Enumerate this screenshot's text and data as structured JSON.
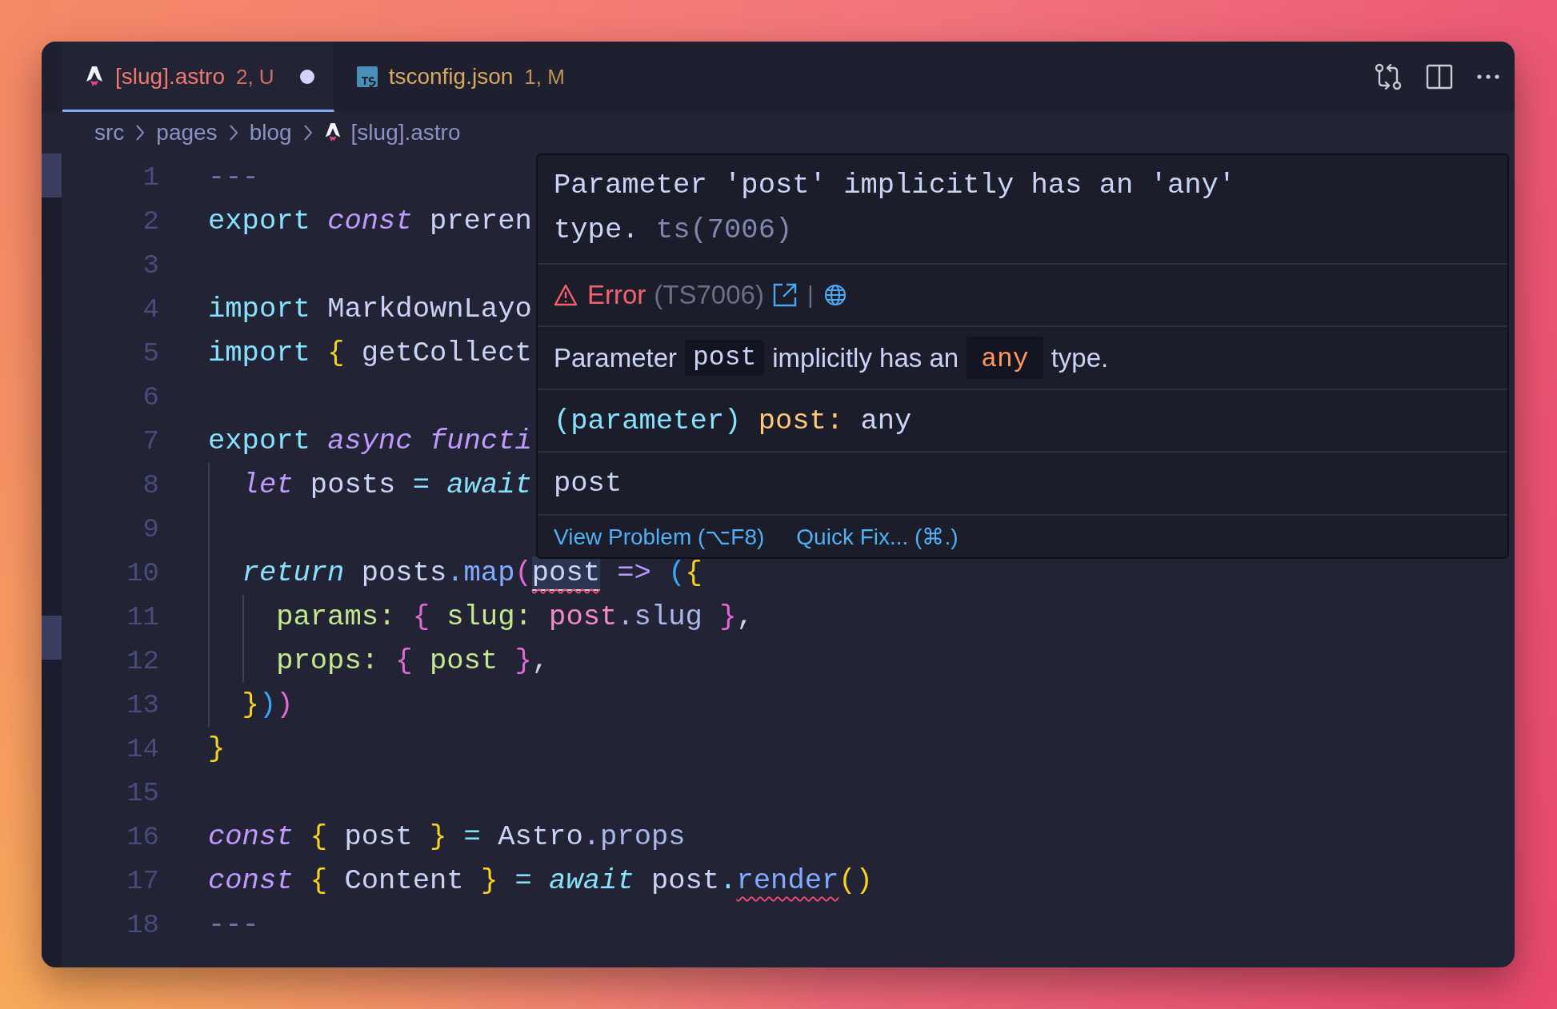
{
  "tabs": [
    {
      "label": "[slug].astro",
      "status": "2, U",
      "kind": "astro",
      "color": "#f0786e",
      "selected": true,
      "dirty": true
    },
    {
      "label": "tsconfig.json",
      "status": "1, M",
      "kind": "ts",
      "color": "#d9a85f",
      "selected": false,
      "dirty": false
    }
  ],
  "breadcrumb": [
    {
      "label": "src",
      "kind": "folder"
    },
    {
      "label": "pages",
      "kind": "folder"
    },
    {
      "label": "blog",
      "kind": "folder"
    },
    {
      "label": "[slug].astro",
      "kind": "astro"
    }
  ],
  "editor": {
    "lines": [
      {
        "number": "1",
        "tokens": [
          {
            "text": "---",
            "kind": "muted"
          }
        ]
      },
      {
        "number": "2",
        "tokens": [
          {
            "text": "export",
            "kind": "keyword"
          },
          {
            "text": " const",
            "kind": "storage"
          },
          {
            "text": " preren",
            "kind": "plain"
          }
        ]
      },
      {
        "number": "3"
      },
      {
        "number": "4",
        "tokens": [
          {
            "text": "import",
            "kind": "keyword"
          },
          {
            "text": " MarkdownLayo",
            "kind": "plain"
          }
        ]
      },
      {
        "number": "5",
        "tokens": [
          {
            "text": "import",
            "kind": "keyword"
          },
          {
            "text": " {",
            "kind": "yellow"
          },
          {
            "text": " getCollect",
            "kind": "plain"
          }
        ]
      },
      {
        "number": "6"
      },
      {
        "number": "7",
        "tokens": [
          {
            "text": "export",
            "kind": "keyword"
          },
          {
            "text": " async functi",
            "kind": "storage"
          }
        ]
      },
      {
        "number": "8",
        "tokens": [
          {
            "text": "  let",
            "kind": "storage"
          },
          {
            "text": " posts ",
            "kind": "plain"
          },
          {
            "text": "=",
            "kind": "keyword"
          },
          {
            "text": " await",
            "kind": "flow"
          }
        ]
      },
      {
        "number": "9"
      },
      {
        "number": "10",
        "tokens": [
          {
            "text": "  return",
            "kind": "flow"
          },
          {
            "text": " posts",
            "kind": "plain"
          },
          {
            "text": ".map",
            "kind": "method"
          },
          {
            "text": "(",
            "kind": "pink"
          },
          {
            "text": "post",
            "kind": "hovered-error"
          },
          {
            "text": " =>",
            "kind": "arrow"
          },
          {
            "text": " (",
            "kind": "blue"
          },
          {
            "text": "{",
            "kind": "yellow"
          }
        ]
      },
      {
        "number": "11",
        "tokens": [
          {
            "text": "    params:",
            "kind": "prop"
          },
          {
            "text": " {",
            "kind": "pink"
          },
          {
            "text": " slug:",
            "kind": "prop"
          },
          {
            "text": " post",
            "kind": "rose"
          },
          {
            "text": ".slug",
            "kind": "member"
          },
          {
            "text": " }",
            "kind": "pink"
          },
          {
            "text": ",",
            "kind": "plain"
          }
        ]
      },
      {
        "number": "12",
        "tokens": [
          {
            "text": "    props:",
            "kind": "prop"
          },
          {
            "text": " {",
            "kind": "pink"
          },
          {
            "text": " post ",
            "kind": "prop"
          },
          {
            "text": "}",
            "kind": "pink"
          },
          {
            "text": ",",
            "kind": "plain"
          }
        ]
      },
      {
        "number": "13",
        "tokens": [
          {
            "text": "  }",
            "kind": "yellow"
          },
          {
            "text": ")",
            "kind": "blue"
          },
          {
            "text": ")",
            "kind": "pink"
          }
        ]
      },
      {
        "number": "14",
        "tokens": [
          {
            "text": "}",
            "kind": "yellow"
          }
        ]
      },
      {
        "number": "15"
      },
      {
        "number": "16",
        "tokens": [
          {
            "text": "const",
            "kind": "storage"
          },
          {
            "text": " {",
            "kind": "yellow"
          },
          {
            "text": " post ",
            "kind": "plain"
          },
          {
            "text": "}",
            "kind": "yellow"
          },
          {
            "text": " =",
            "kind": "keyword"
          },
          {
            "text": " Astro",
            "kind": "plain"
          },
          {
            "text": ".props",
            "kind": "member"
          }
        ]
      },
      {
        "number": "17",
        "tokens": [
          {
            "text": "const",
            "kind": "storage"
          },
          {
            "text": " {",
            "kind": "yellow"
          },
          {
            "text": " Content ",
            "kind": "plain"
          },
          {
            "text": "}",
            "kind": "yellow"
          },
          {
            "text": " =",
            "kind": "keyword"
          },
          {
            "text": " await",
            "kind": "flow"
          },
          {
            "text": " post",
            "kind": "plain"
          },
          {
            "text": ".",
            "kind": "keyword"
          },
          {
            "text": "render",
            "kind": "method-error"
          },
          {
            "text": "()",
            "kind": "yellow"
          }
        ]
      },
      {
        "number": "18",
        "tokens": [
          {
            "text": "---",
            "kind": "muted"
          }
        ]
      }
    ]
  },
  "hover": {
    "message": "Parameter 'post' implicitly has an 'any' type.",
    "message_code": "ts(7006)",
    "problem": {
      "label": "Error",
      "code": "(TS7006)",
      "separator": "|"
    },
    "description": [
      {
        "text": "Parameter",
        "kind": "text"
      },
      {
        "text": "post",
        "kind": "code"
      },
      {
        "text": "implicitly has an",
        "kind": "text"
      },
      {
        "text": "any",
        "kind": "type"
      },
      {
        "text": "type.",
        "kind": "text"
      }
    ],
    "signature": [
      {
        "text": "(parameter)",
        "kind": "paren"
      },
      {
        "text": " post:",
        "kind": "name"
      },
      {
        "text": " any",
        "kind": "plain"
      }
    ],
    "detail": "post",
    "actions": [
      "View Problem (⌥F8)",
      "Quick Fix... (⌘.)"
    ]
  }
}
